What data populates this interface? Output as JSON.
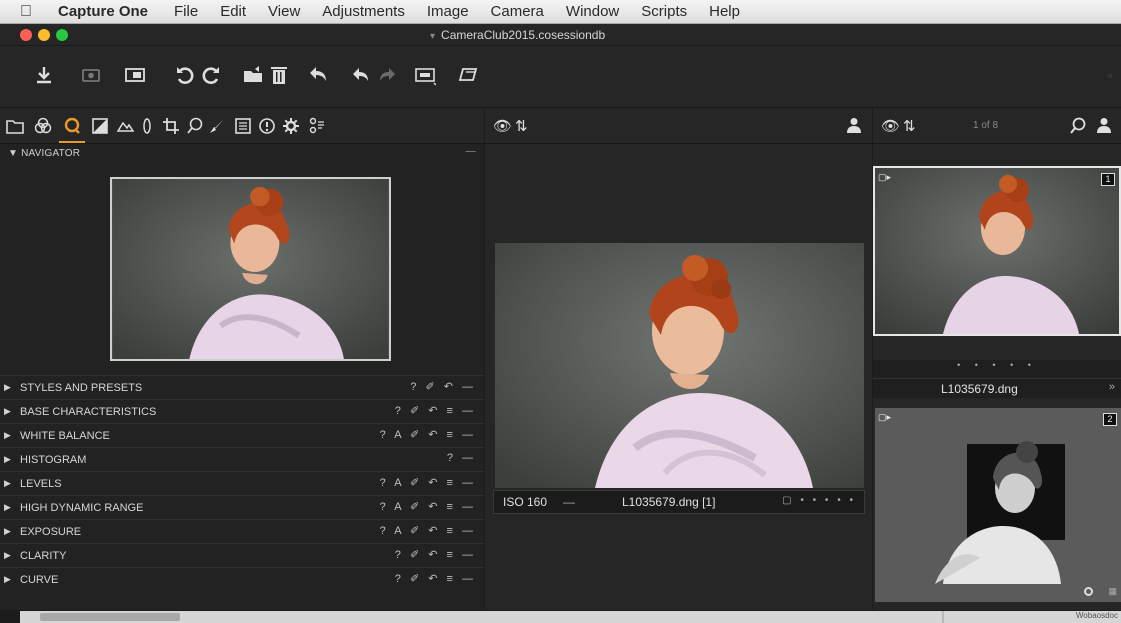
{
  "menubar": {
    "apple_icon": "apple-icon",
    "app_name": "Capture One",
    "items": [
      "File",
      "Edit",
      "View",
      "Adjustments",
      "Image",
      "Camera",
      "Window",
      "Scripts",
      "Help"
    ]
  },
  "window": {
    "title": "CameraClub2015.cosessiondb",
    "traffic_lights": {
      "close": "#fc5f57",
      "minimize": "#fdbc2e",
      "zoom": "#28c840"
    }
  },
  "toolbar": {
    "buttons": [
      "import-icon",
      "capture-icon",
      "live-view-icon",
      "rotate-left-icon",
      "rotate-right-icon",
      "move-icon",
      "trash-icon",
      "undo-icon",
      "undo2-icon",
      "redo-icon",
      "proofing-icon",
      "tethering-icon"
    ],
    "more": "»"
  },
  "tool_tabs": {
    "tabs": [
      "library-icon",
      "capture-icon",
      "lens-icon",
      "color-icon",
      "exposure-icon",
      "detail-icon",
      "local-adjust-icon",
      "crop-icon",
      "focus-icon",
      "picker-icon",
      "metadata-icon",
      "info-icon",
      "settings-icon",
      "batch-icon"
    ],
    "active_color": "#e89a2b"
  },
  "navigator": {
    "label": "NAVIGATOR",
    "collapse": "—"
  },
  "tool_panels": [
    {
      "label": "STYLES AND PRESETS",
      "icons": "? ✐ ↶ —"
    },
    {
      "label": "BASE CHARACTERISTICS",
      "icons": "? ✐ ↶ ≡ —"
    },
    {
      "label": "WHITE BALANCE",
      "icons": "? A ✐ ↶ ≡ —"
    },
    {
      "label": "HISTOGRAM",
      "icons": "? —"
    },
    {
      "label": "LEVELS",
      "icons": "? A ✐ ↶ ≡ —"
    },
    {
      "label": "HIGH DYNAMIC RANGE",
      "icons": "? A ✐ ↶ ≡ —"
    },
    {
      "label": "EXPOSURE",
      "icons": "? A ✐ ↶ ≡ —"
    },
    {
      "label": "CLARITY",
      "icons": "? ✐ ↶ ≡ —"
    },
    {
      "label": "CURVE",
      "icons": "? ✐ ↶ ≡ —"
    }
  ],
  "viewer": {
    "iso": "ISO 160",
    "dash": "—",
    "filename": "L1035679.dng [1]",
    "controls": "▢ • • • • •"
  },
  "browser": {
    "counter": "1 of 8",
    "thumbs": [
      {
        "name": "L1035679.dng",
        "badge": "1",
        "rating": "• • • • •"
      },
      {
        "badge": "2"
      }
    ],
    "more": "»"
  },
  "statusbar": {
    "corner_text": "Wobaosdoc"
  }
}
